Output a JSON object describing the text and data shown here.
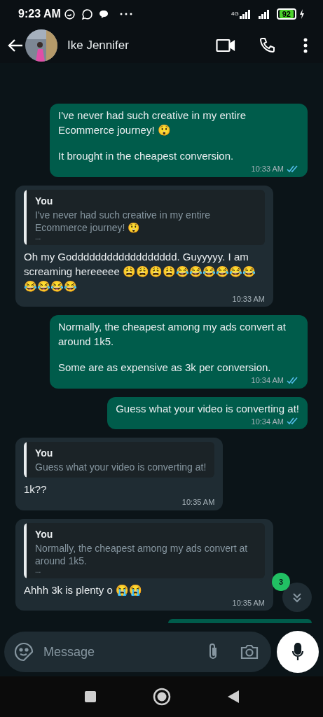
{
  "status_bar": {
    "time": "9:23 AM",
    "network": "4G",
    "battery": "92"
  },
  "header": {
    "contact": "Ike Jennifer"
  },
  "messages": [
    {
      "kind": "outgoing",
      "paragraphs": [
        "I've never had such creative in my entire Ecommerce journey! 😲",
        "It brought in the cheapest conversion."
      ],
      "time": "10:33 AM",
      "read": true
    },
    {
      "kind": "incoming",
      "quote": {
        "author": "You",
        "text": "I've never had such creative in my entire Ecommerce journey! 😲",
        "more": "..."
      },
      "paragraphs": [
        "Oh my Godddddddddddddddddd. Guyyyyy. I am screaming hereeeee 😩😩😩😩😂😂😂😂😂😂😂😂😂😂"
      ],
      "time": "10:33 AM"
    },
    {
      "kind": "outgoing",
      "paragraphs": [
        "Normally, the cheapest among my ads convert at around 1k5.",
        "Some are as expensive as 3k per conversion."
      ],
      "time": "10:34 AM",
      "read": true
    },
    {
      "kind": "outgoing",
      "paragraphs": [
        "Guess what your video is converting at!"
      ],
      "time": "10:34 AM",
      "read": true
    },
    {
      "kind": "incoming",
      "quote": {
        "author": "You",
        "text": "Guess what your video is converting at!"
      },
      "paragraphs": [
        "1k??"
      ],
      "time": "10:35 AM"
    },
    {
      "kind": "incoming",
      "quote": {
        "author": "You",
        "text": "Normally, the cheapest among my ads convert at around 1k5.",
        "more": "..."
      },
      "paragraphs": [
        "Ahhh 3k is plenty o 😭😭"
      ],
      "time": "10:35 AM"
    },
    {
      "kind": "outgoing-partial"
    }
  ],
  "scroll_button": {
    "unread": "3"
  },
  "composer": {
    "placeholder": "Message"
  }
}
